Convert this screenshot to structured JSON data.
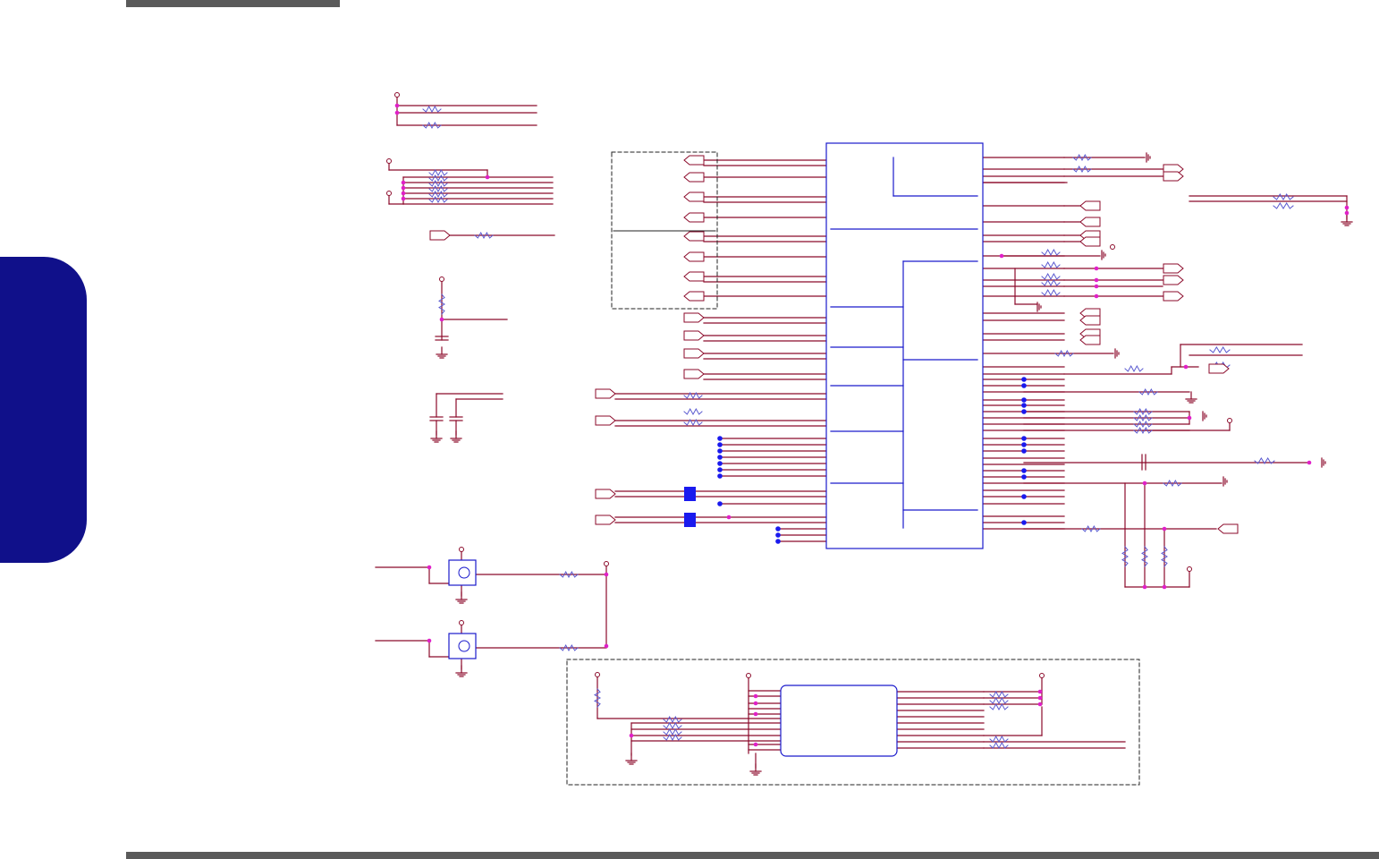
{
  "page": {
    "colors": {
      "background": "#ffffff",
      "frame": "#5a5a5a",
      "tab": "#10108a",
      "wire": "#8b0a2a",
      "bus": "#1a1acc",
      "junction": "#e020c8",
      "node": "#1a1aee",
      "resistor": "#5a5ad0"
    }
  }
}
